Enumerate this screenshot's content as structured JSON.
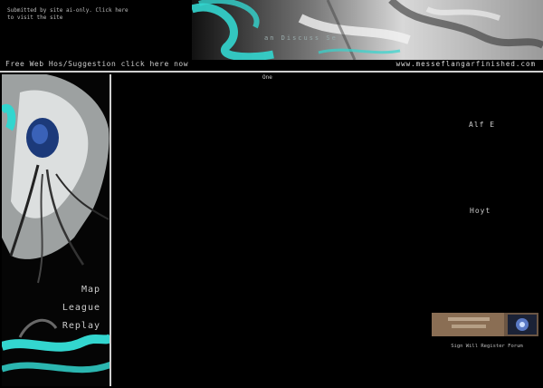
{
  "header": {
    "meta_lines": [
      "Submitted by site ai-only. Click here",
      "to visit the site"
    ],
    "title": "an Discuss Se",
    "nav_text": "Free Web Hos/Suggestion click here now",
    "nav_url": "www.messeflangarfinished.com"
  },
  "main": {
    "heading": "One",
    "side_text_1": "Alf E",
    "side_text_2": "Hoyt"
  },
  "sidebar": {
    "links": [
      "Map",
      "League",
      "Replay"
    ]
  },
  "promo": {
    "caption": "Sign Will Register Forum"
  },
  "colors": {
    "background": "#000000",
    "accent": "#33d6cf",
    "divider": "#cfcfcf"
  }
}
